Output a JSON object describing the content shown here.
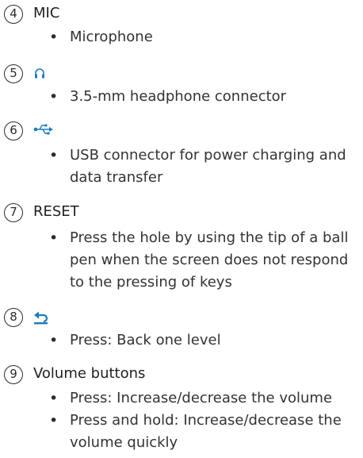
{
  "items": [
    {
      "num": "4",
      "title": "MIC",
      "icon": null,
      "bullets": [
        "Microphone"
      ]
    },
    {
      "num": "5",
      "title": "",
      "icon": "headphone-icon",
      "bullets": [
        "3.5-mm headphone connector"
      ]
    },
    {
      "num": "6",
      "title": "",
      "icon": "usb-icon",
      "bullets": [
        "USB connector for power charging and data transfer"
      ]
    },
    {
      "num": "7",
      "title": "RESET",
      "icon": null,
      "bullets": [
        "Press the hole by using the tip of a ball pen when the screen does not respond to the pressing of keys"
      ]
    },
    {
      "num": "8",
      "title": "",
      "icon": "back-icon",
      "bullets": [
        "Press: Back one level"
      ]
    },
    {
      "num": "9",
      "title": "Volume buttons",
      "icon": null,
      "bullets": [
        "Press: Increase/decrease the volume",
        "Press and hold: Increase/decrease the volume quickly"
      ]
    }
  ],
  "colors": {
    "text": "#2b2b2b",
    "icon": "#1a7bbf"
  }
}
